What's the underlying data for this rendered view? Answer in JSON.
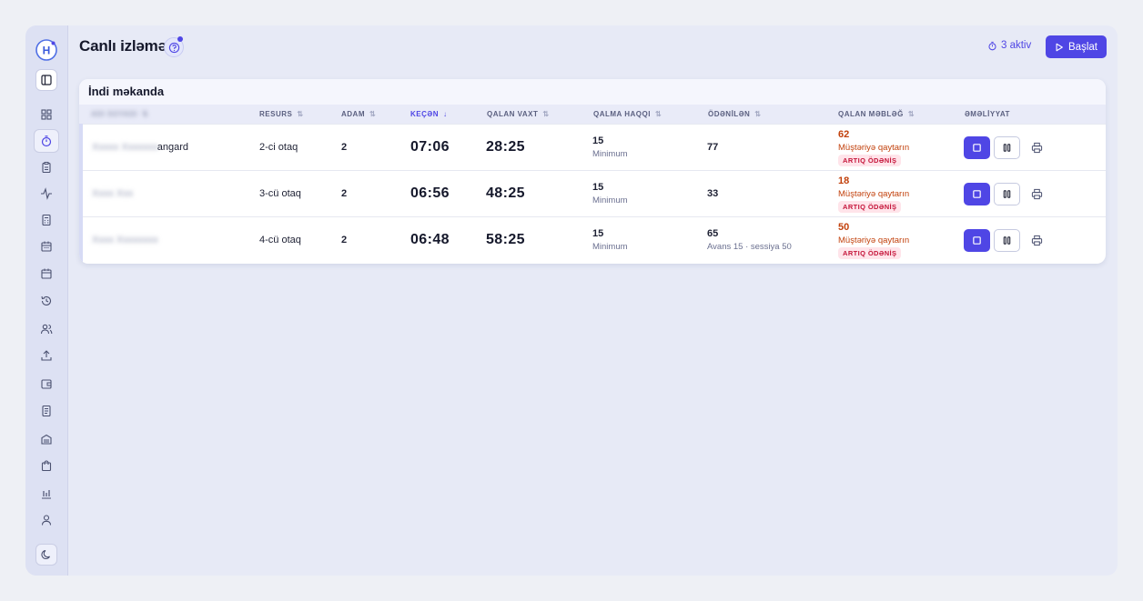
{
  "header": {
    "title": "Canlı izləmə",
    "active_count": "3 aktiv",
    "start_label": "Başlat"
  },
  "sidebar": {
    "items": [
      {
        "icon": "layout-grid-icon"
      },
      {
        "icon": "timer-icon",
        "active": true
      },
      {
        "icon": "clipboard-icon"
      },
      {
        "icon": "activity-icon"
      },
      {
        "icon": "calculator-icon"
      },
      {
        "icon": "calendar-days-icon"
      },
      {
        "icon": "calendar-icon"
      },
      {
        "icon": "history-icon"
      },
      {
        "icon": "users-icon"
      },
      {
        "icon": "upload-icon"
      },
      {
        "icon": "wallet-icon"
      },
      {
        "icon": "receipt-icon"
      },
      {
        "icon": "warehouse-icon"
      },
      {
        "icon": "shopping-bag-icon"
      },
      {
        "icon": "bar-chart-icon"
      },
      {
        "icon": "user-icon"
      }
    ]
  },
  "table": {
    "title": "İndi məkanda",
    "columns": {
      "name": "",
      "resource": "RESURS",
      "people": "ADAM",
      "elapsed": "KEÇƏN",
      "remaining_time": "QALAN VAXT",
      "stay_fee": "QALMA HAQQI",
      "paid": "ÖDƏNİLƏN",
      "remaining_amount": "QALAN MƏBLƏĞ",
      "actions": "ƏMƏLİYYAT"
    },
    "rows": [
      {
        "name": "angard",
        "resource": "2-ci otaq",
        "people": "2",
        "elapsed": "07:06",
        "remaining_time": "28:25",
        "stay_fee": "15",
        "stay_fee_note": "Minimum",
        "paid": "77",
        "paid_note": "",
        "remaining_amount": "62",
        "remaining_note": "Müştəriyə qaytarın",
        "badge": "ARTIQ ÖDƏNİŞ"
      },
      {
        "name": "",
        "resource": "3-cü otaq",
        "people": "2",
        "elapsed": "06:56",
        "remaining_time": "48:25",
        "stay_fee": "15",
        "stay_fee_note": "Minimum",
        "paid": "33",
        "paid_note": "",
        "remaining_amount": "18",
        "remaining_note": "Müştəriyə qaytarın",
        "badge": "ARTIQ ÖDƏNİŞ"
      },
      {
        "name": "",
        "resource": "4-cü otaq",
        "people": "2",
        "elapsed": "06:48",
        "remaining_time": "58:25",
        "stay_fee": "15",
        "stay_fee_note": "Minimum",
        "paid": "65",
        "paid_note": "Avans 15 · sessiya 50",
        "remaining_amount": "50",
        "remaining_note": "Müştəriyə qaytarın",
        "badge": "ARTIQ ÖDƏNİŞ"
      }
    ]
  },
  "colors": {
    "accent": "#4f46e5",
    "warning": "#c2410c",
    "badge_text": "#c5163b",
    "badge_bg": "#ffe4ea"
  }
}
